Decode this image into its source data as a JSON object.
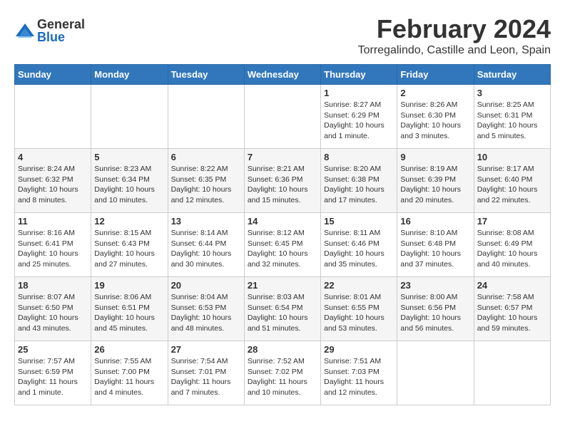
{
  "logo": {
    "general": "General",
    "blue": "Blue"
  },
  "title": {
    "month": "February 2024",
    "location": "Torregalindo, Castille and Leon, Spain"
  },
  "headers": [
    "Sunday",
    "Monday",
    "Tuesday",
    "Wednesday",
    "Thursday",
    "Friday",
    "Saturday"
  ],
  "weeks": [
    [
      {
        "day": "",
        "info": ""
      },
      {
        "day": "",
        "info": ""
      },
      {
        "day": "",
        "info": ""
      },
      {
        "day": "",
        "info": ""
      },
      {
        "day": "1",
        "info": "Sunrise: 8:27 AM\nSunset: 6:29 PM\nDaylight: 10 hours\nand 1 minute."
      },
      {
        "day": "2",
        "info": "Sunrise: 8:26 AM\nSunset: 6:30 PM\nDaylight: 10 hours\nand 3 minutes."
      },
      {
        "day": "3",
        "info": "Sunrise: 8:25 AM\nSunset: 6:31 PM\nDaylight: 10 hours\nand 5 minutes."
      }
    ],
    [
      {
        "day": "4",
        "info": "Sunrise: 8:24 AM\nSunset: 6:32 PM\nDaylight: 10 hours\nand 8 minutes."
      },
      {
        "day": "5",
        "info": "Sunrise: 8:23 AM\nSunset: 6:34 PM\nDaylight: 10 hours\nand 10 minutes."
      },
      {
        "day": "6",
        "info": "Sunrise: 8:22 AM\nSunset: 6:35 PM\nDaylight: 10 hours\nand 12 minutes."
      },
      {
        "day": "7",
        "info": "Sunrise: 8:21 AM\nSunset: 6:36 PM\nDaylight: 10 hours\nand 15 minutes."
      },
      {
        "day": "8",
        "info": "Sunrise: 8:20 AM\nSunset: 6:38 PM\nDaylight: 10 hours\nand 17 minutes."
      },
      {
        "day": "9",
        "info": "Sunrise: 8:19 AM\nSunset: 6:39 PM\nDaylight: 10 hours\nand 20 minutes."
      },
      {
        "day": "10",
        "info": "Sunrise: 8:17 AM\nSunset: 6:40 PM\nDaylight: 10 hours\nand 22 minutes."
      }
    ],
    [
      {
        "day": "11",
        "info": "Sunrise: 8:16 AM\nSunset: 6:41 PM\nDaylight: 10 hours\nand 25 minutes."
      },
      {
        "day": "12",
        "info": "Sunrise: 8:15 AM\nSunset: 6:43 PM\nDaylight: 10 hours\nand 27 minutes."
      },
      {
        "day": "13",
        "info": "Sunrise: 8:14 AM\nSunset: 6:44 PM\nDaylight: 10 hours\nand 30 minutes."
      },
      {
        "day": "14",
        "info": "Sunrise: 8:12 AM\nSunset: 6:45 PM\nDaylight: 10 hours\nand 32 minutes."
      },
      {
        "day": "15",
        "info": "Sunrise: 8:11 AM\nSunset: 6:46 PM\nDaylight: 10 hours\nand 35 minutes."
      },
      {
        "day": "16",
        "info": "Sunrise: 8:10 AM\nSunset: 6:48 PM\nDaylight: 10 hours\nand 37 minutes."
      },
      {
        "day": "17",
        "info": "Sunrise: 8:08 AM\nSunset: 6:49 PM\nDaylight: 10 hours\nand 40 minutes."
      }
    ],
    [
      {
        "day": "18",
        "info": "Sunrise: 8:07 AM\nSunset: 6:50 PM\nDaylight: 10 hours\nand 43 minutes."
      },
      {
        "day": "19",
        "info": "Sunrise: 8:06 AM\nSunset: 6:51 PM\nDaylight: 10 hours\nand 45 minutes."
      },
      {
        "day": "20",
        "info": "Sunrise: 8:04 AM\nSunset: 6:53 PM\nDaylight: 10 hours\nand 48 minutes."
      },
      {
        "day": "21",
        "info": "Sunrise: 8:03 AM\nSunset: 6:54 PM\nDaylight: 10 hours\nand 51 minutes."
      },
      {
        "day": "22",
        "info": "Sunrise: 8:01 AM\nSunset: 6:55 PM\nDaylight: 10 hours\nand 53 minutes."
      },
      {
        "day": "23",
        "info": "Sunrise: 8:00 AM\nSunset: 6:56 PM\nDaylight: 10 hours\nand 56 minutes."
      },
      {
        "day": "24",
        "info": "Sunrise: 7:58 AM\nSunset: 6:57 PM\nDaylight: 10 hours\nand 59 minutes."
      }
    ],
    [
      {
        "day": "25",
        "info": "Sunrise: 7:57 AM\nSunset: 6:59 PM\nDaylight: 11 hours\nand 1 minute."
      },
      {
        "day": "26",
        "info": "Sunrise: 7:55 AM\nSunset: 7:00 PM\nDaylight: 11 hours\nand 4 minutes."
      },
      {
        "day": "27",
        "info": "Sunrise: 7:54 AM\nSunset: 7:01 PM\nDaylight: 11 hours\nand 7 minutes."
      },
      {
        "day": "28",
        "info": "Sunrise: 7:52 AM\nSunset: 7:02 PM\nDaylight: 11 hours\nand 10 minutes."
      },
      {
        "day": "29",
        "info": "Sunrise: 7:51 AM\nSunset: 7:03 PM\nDaylight: 11 hours\nand 12 minutes."
      },
      {
        "day": "",
        "info": ""
      },
      {
        "day": "",
        "info": ""
      }
    ]
  ]
}
